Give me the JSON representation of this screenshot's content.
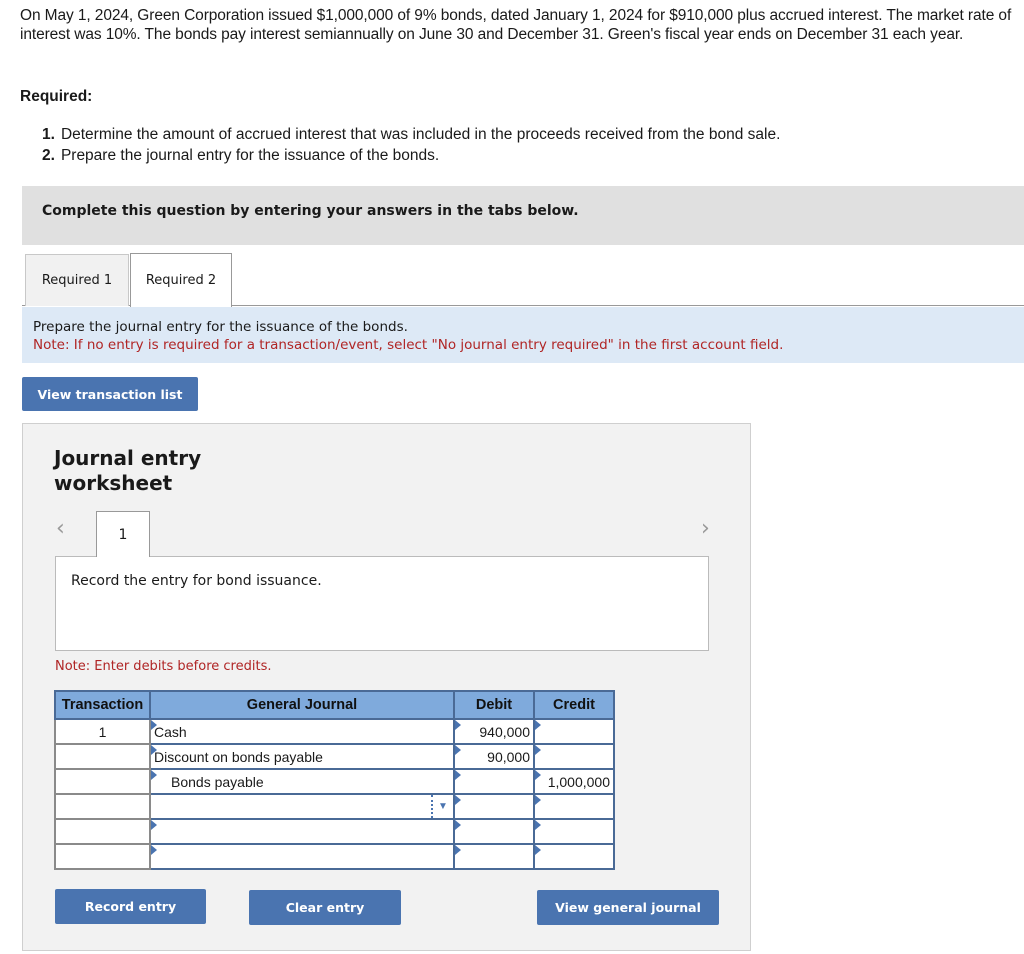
{
  "problem": {
    "text": "On May 1, 2024, Green Corporation issued $1,000,000 of 9% bonds, dated January 1, 2024 for $910,000 plus accrued interest. The market rate of interest was 10%. The bonds pay interest semiannually on June 30 and December 31. Green's fiscal year ends on December 31 each year.",
    "required_label": "Required:",
    "requirements": [
      {
        "num": "1.",
        "text": "Determine the amount of accrued interest that was included in the proceeds received from the bond sale."
      },
      {
        "num": "2.",
        "text": "Prepare the journal entry for the issuance of the bonds."
      }
    ]
  },
  "complete_banner": "Complete this question by entering your answers in the tabs below.",
  "tabs": [
    {
      "label": "Required 1",
      "active": false
    },
    {
      "label": "Required 2",
      "active": true
    }
  ],
  "instructions": {
    "main": "Prepare the journal entry for the issuance of the bonds.",
    "note": "Note: If no entry is required for a transaction/event, select \"No journal entry required\" in the first account field."
  },
  "view_transaction_list": "View transaction list",
  "worksheet": {
    "title_line1": "Journal entry",
    "title_line2": "worksheet",
    "prev_icon": "‹",
    "next_icon": "›",
    "entry_tab": "1",
    "description": "Record the entry for bond issuance.",
    "note": "Note: Enter debits before credits.",
    "table": {
      "headers": [
        "Transaction",
        "General Journal",
        "Debit",
        "Credit"
      ],
      "rows": [
        {
          "transaction": "1",
          "account": "Cash",
          "debit": "940,000",
          "credit": ""
        },
        {
          "transaction": "",
          "account": "Discount on bonds payable",
          "debit": "90,000",
          "credit": ""
        },
        {
          "transaction": "",
          "account": "Bonds payable",
          "debit": "",
          "credit": "1,000,000"
        },
        {
          "transaction": "",
          "account": "",
          "debit": "",
          "credit": ""
        },
        {
          "transaction": "",
          "account": "",
          "debit": "",
          "credit": ""
        },
        {
          "transaction": "",
          "account": "",
          "debit": "",
          "credit": ""
        }
      ]
    },
    "buttons": {
      "record": "Record entry",
      "clear": "Clear entry",
      "view_general_journal": "View general journal"
    }
  },
  "colors": {
    "button_blue": "#4a74b0",
    "header_blue": "#7faadc",
    "note_red": "#b02525",
    "instruction_bg": "#dde9f6"
  }
}
